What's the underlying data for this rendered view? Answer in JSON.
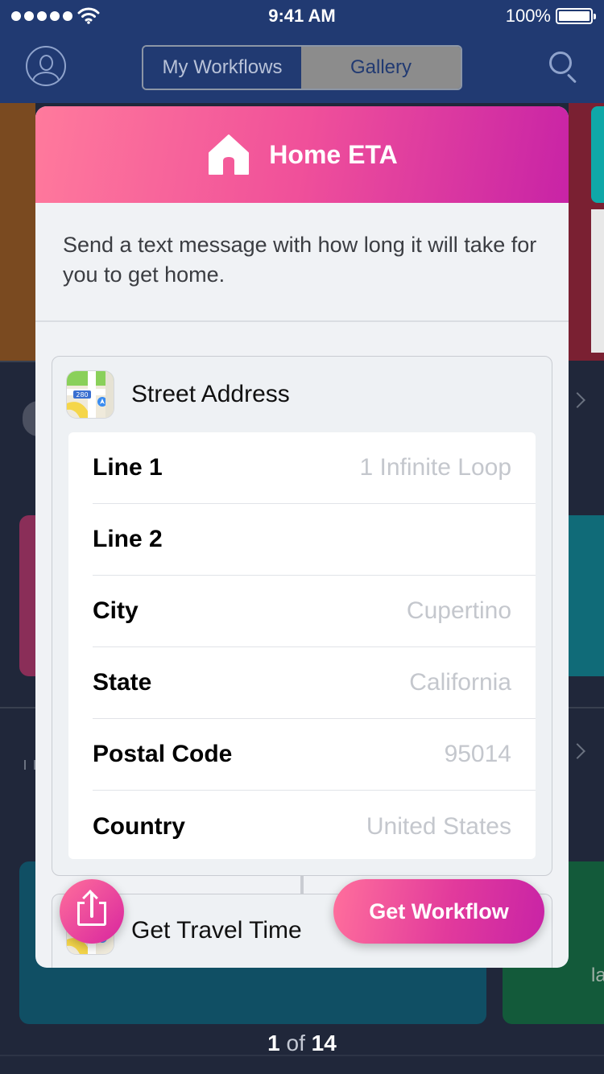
{
  "status_bar": {
    "time": "9:41 AM",
    "battery": "100%"
  },
  "nav": {
    "segments": [
      "My Workflows",
      "Gallery"
    ],
    "selected_segment": "Gallery"
  },
  "card": {
    "title": "Home ETA",
    "description": "Send a text message with how long it will take for you to get home.",
    "header_gradient": [
      "#ff7a9c",
      "#c823a6"
    ],
    "actions": [
      {
        "title": "Street Address",
        "icon": "maps-icon",
        "fields": [
          {
            "label": "Line 1",
            "placeholder": "1 Infinite Loop"
          },
          {
            "label": "Line 2",
            "placeholder": ""
          },
          {
            "label": "City",
            "placeholder": "Cupertino"
          },
          {
            "label": "State",
            "placeholder": "California"
          },
          {
            "label": "Postal Code",
            "placeholder": "95014"
          },
          {
            "label": "Country",
            "placeholder": "United States"
          }
        ]
      },
      {
        "title": "Get Travel Time",
        "icon": "maps-icon"
      }
    ]
  },
  "buttons": {
    "share_icon": "share-icon",
    "get_workflow": "Get Workflow"
  },
  "pagination": {
    "current": "1",
    "separator": "of",
    "total": "14"
  },
  "background": {
    "partial_text": "la"
  }
}
